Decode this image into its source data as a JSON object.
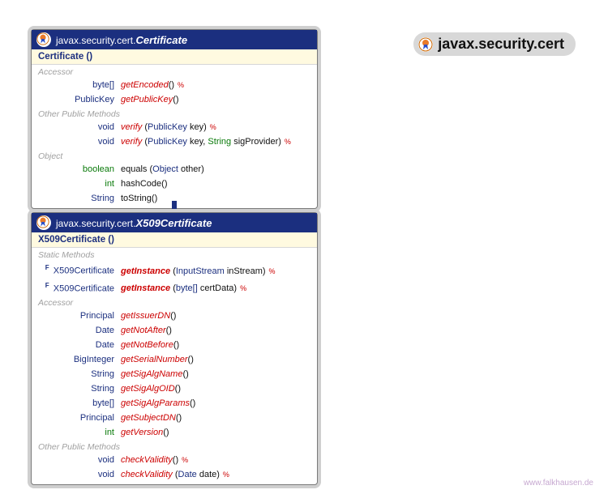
{
  "title": "javax.security.cert",
  "footer": "www.falkhausen.de",
  "iconLabel": "cert",
  "certBox": {
    "pkg": "javax.security.cert.",
    "cls": "Certificate",
    "ctor": "Certificate ()",
    "sections": {
      "accessor": "Accessor",
      "other": "Other Public Methods",
      "object": "Object"
    },
    "methods": {
      "getEncoded": {
        "ret": "byte[]",
        "name": "getEncoded",
        "params": "()"
      },
      "getPublicKey": {
        "ret": "PublicKey",
        "name": "getPublicKey",
        "params": "()"
      },
      "verify1": {
        "ret": "void",
        "name": "verify",
        "p": "(PublicKey key)"
      },
      "verify2": {
        "ret": "void",
        "name": "verify",
        "p1": "(PublicKey key, ",
        "pt2": "String",
        "p2": " sigProvider)"
      },
      "equals": {
        "ret": "boolean",
        "name": "equals",
        "p": "(Object other)"
      },
      "hashCode": {
        "ret": "int",
        "name": "hashCode",
        "p": "()"
      },
      "toString": {
        "ret": "String",
        "name": "toString",
        "p": "()"
      }
    }
  },
  "x509Box": {
    "pkg": "javax.security.cert.",
    "cls": "X509Certificate",
    "ctor": "X509Certificate ()",
    "sections": {
      "static": "Static Methods",
      "accessor": "Accessor",
      "other": "Other Public Methods"
    },
    "methods": {
      "getInst1": {
        "ret": "X509Certificate",
        "name": "getInstance",
        "p": "(InputStream inStream)"
      },
      "getInst2": {
        "ret": "X509Certificate",
        "name": "getInstance",
        "p": "(byte[] certData)"
      },
      "getIssuerDN": {
        "ret": "Principal",
        "name": "getIssuerDN",
        "p": "()"
      },
      "getNotAfter": {
        "ret": "Date",
        "name": "getNotAfter",
        "p": "()"
      },
      "getNotBefore": {
        "ret": "Date",
        "name": "getNotBefore",
        "p": "()"
      },
      "getSerialNumber": {
        "ret": "BigInteger",
        "name": "getSerialNumber",
        "p": "()"
      },
      "getSigAlgName": {
        "ret": "String",
        "name": "getSigAlgName",
        "p": "()"
      },
      "getSigAlgOID": {
        "ret": "String",
        "name": "getSigAlgOID",
        "p": "()"
      },
      "getSigAlgParams": {
        "ret": "byte[]",
        "name": "getSigAlgParams",
        "p": "()"
      },
      "getSubjectDN": {
        "ret": "Principal",
        "name": "getSubjectDN",
        "p": "()"
      },
      "getVersion": {
        "ret": "int",
        "name": "getVersion",
        "p": "()"
      },
      "checkValidity1": {
        "ret": "void",
        "name": "checkValidity",
        "p": "()"
      },
      "checkValidity2": {
        "ret": "void",
        "name": "checkValidity",
        "p": "(Date date)"
      }
    }
  },
  "markers": {
    "throws": "%",
    "final": "F"
  }
}
